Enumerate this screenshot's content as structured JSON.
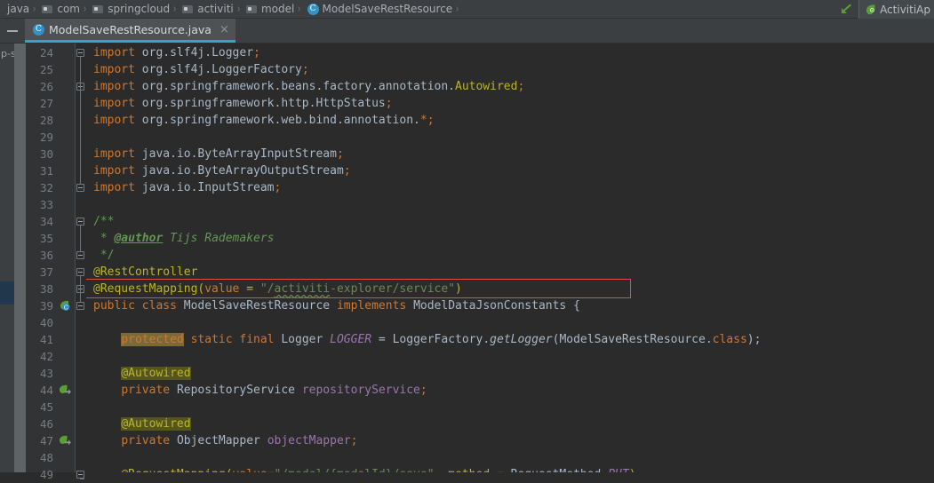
{
  "breadcrumb": {
    "items": [
      {
        "label": "java",
        "icon": "none"
      },
      {
        "label": "com",
        "icon": "folder-icon"
      },
      {
        "label": "springcloud",
        "icon": "folder-icon"
      },
      {
        "label": "activiti",
        "icon": "folder-icon"
      },
      {
        "label": "model",
        "icon": "folder-icon"
      },
      {
        "label": "ModelSaveRestResource",
        "icon": "class-icon"
      }
    ],
    "separator": "›"
  },
  "run_config": {
    "arrow_icon": "run-back-arrow-icon",
    "app_icon": "activiti-leaf-icon",
    "label": "ActivitiAp"
  },
  "tabs": {
    "collapse_label": "—",
    "items": [
      {
        "label": "ModelSaveRestResource.java",
        "icon": "class-icon",
        "close": "×",
        "active": true
      }
    ]
  },
  "tool_stripe": {
    "label": "p-sp"
  },
  "editor": {
    "first_line": 24,
    "line_height": 19,
    "gutter_icons": [
      {
        "line": 39,
        "name": "spring-bean-class-icon"
      },
      {
        "line": 44,
        "name": "spring-bean-autowired-icon"
      },
      {
        "line": 47,
        "name": "spring-bean-autowired-icon"
      }
    ],
    "highlight_box": {
      "line": 38,
      "label": "request-mapping-highlight"
    },
    "lines": [
      {
        "n": 24,
        "html": "<span class=\"kw\">import</span> <span class=\"id\">org.slf4j.Logger</span><span class=\"kw\">;</span>"
      },
      {
        "n": 25,
        "html": "<span class=\"kw\">import</span> <span class=\"id\">org.slf4j.LoggerFactory</span><span class=\"kw\">;</span>"
      },
      {
        "n": 26,
        "html": "<span class=\"kw\">import</span> <span class=\"id\">org.springframework.beans.factory.annotation.</span><span class=\"ann\">Autowired</span><span class=\"kw\">;</span>"
      },
      {
        "n": 27,
        "html": "<span class=\"kw\">import</span> <span class=\"id\">org.springframework.http.HttpStatus</span><span class=\"kw\">;</span>"
      },
      {
        "n": 28,
        "html": "<span class=\"kw\">import</span> <span class=\"id\">org.springframework.web.bind.annotation.</span><span class=\"kw\">*;</span>"
      },
      {
        "n": 29,
        "html": ""
      },
      {
        "n": 30,
        "html": "<span class=\"kw\">import</span> <span class=\"id\">java.io.ByteArrayInputStream</span><span class=\"kw\">;</span>"
      },
      {
        "n": 31,
        "html": "<span class=\"kw\">import</span> <span class=\"id\">java.io.ByteArrayOutputStream</span><span class=\"kw\">;</span>"
      },
      {
        "n": 32,
        "html": "<span class=\"kw\">import</span> <span class=\"id\">java.io.InputStream</span><span class=\"kw\">;</span>"
      },
      {
        "n": 33,
        "html": ""
      },
      {
        "n": 34,
        "html": "<span class=\"cmt\">/**</span>"
      },
      {
        "n": 35,
        "html": "<span class=\"cmt\"> * </span><span class=\"doctag\">@author</span><span class=\"docitl\"> Tijs Rademakers</span>"
      },
      {
        "n": 36,
        "html": "<span class=\"cmt\"> */</span>"
      },
      {
        "n": 37,
        "html": "<span class=\"ann\">@RestController</span>"
      },
      {
        "n": 38,
        "html": "<span class=\"ann\">@RequestMapping(</span><span class=\"kw\">value</span><span class=\"ann\"> = </span><span class=\"str\">\"/</span><span class=\"str wavy\">activiti</span><span class=\"str\">-explorer/service\"</span><span class=\"ann\">)</span>"
      },
      {
        "n": 39,
        "html": "<span class=\"kw\">public class</span> <span class=\"cls\">ModelSaveRestResource</span> <span class=\"kw\">implements</span> <span class=\"cls\">ModelDataJsonConstants</span> {"
      },
      {
        "n": 40,
        "html": ""
      },
      {
        "n": 41,
        "html": "    <span class=\"kw hl-kwbg\">protected</span> <span class=\"kw\">static final</span> <span class=\"cls\">Logger</span> <span class=\"stat\">LOGGER</span> = <span class=\"cls\">LoggerFactory</span>.<span class=\"mtd\">getLogger</span>(<span class=\"cls\">ModelSaveRestResource</span>.<span class=\"kw\">class</span>);"
      },
      {
        "n": 42,
        "html": ""
      },
      {
        "n": 43,
        "html": "    <span class=\"ann hl-srch\">@Autowired</span>"
      },
      {
        "n": 44,
        "html": "    <span class=\"kw\">private</span> <span class=\"cls\">RepositoryService</span> <span class=\"fld\">repositoryService</span><span class=\"kw\">;</span>"
      },
      {
        "n": 45,
        "html": ""
      },
      {
        "n": 46,
        "html": "    <span class=\"ann hl-srch\">@Autowired</span>"
      },
      {
        "n": 47,
        "html": "    <span class=\"kw\">private</span> <span class=\"cls\">ObjectMapper</span> <span class=\"fld\">objectMapper</span><span class=\"kw\">;</span>"
      },
      {
        "n": 48,
        "html": ""
      },
      {
        "n": 49,
        "html": "    <span class=\"ann\">@RequestMapping(</span><span class=\"kw\">value</span><span class=\"ann\">=</span><span class=\"str\">\"/model/{modelId}/save\"</span><span class=\"ann\">, method = </span><span class=\"cls\">RequestMethod</span><span class=\"ann\">.</span><span class=\"stat\">PUT</span><span class=\"ann\">)</span>"
      }
    ],
    "fold_markers": [
      24,
      26,
      32,
      34,
      36,
      37,
      38,
      39,
      49
    ],
    "source_text": [
      "import org.slf4j.Logger;",
      "import org.slf4j.LoggerFactory;",
      "import org.springframework.beans.factory.annotation.Autowired;",
      "import org.springframework.http.HttpStatus;",
      "import org.springframework.web.bind.annotation.*;",
      "",
      "import java.io.ByteArrayInputStream;",
      "import java.io.ByteArrayOutputStream;",
      "import java.io.InputStream;",
      "",
      "/**",
      " * @author Tijs Rademakers",
      " */",
      "@RestController",
      "@RequestMapping(value = \"/activiti-explorer/service\")",
      "public class ModelSaveRestResource implements ModelDataJsonConstants {",
      "",
      "    protected static final Logger LOGGER = LoggerFactory.getLogger(ModelSaveRestResource.class);",
      "",
      "    @Autowired",
      "    private RepositoryService repositoryService;",
      "",
      "    @Autowired",
      "    private ObjectMapper objectMapper;",
      "",
      "    @RequestMapping(value=\"/model/{modelId}/save\", method = RequestMethod.PUT)"
    ]
  },
  "colors": {
    "editor_bg": "#2b2b2b",
    "gutter_bg": "#313335",
    "chrome_bg": "#3c3f41",
    "tab_active_bg": "#4e5254",
    "tab_underline": "#2fa8c4",
    "keyword": "#cc7832",
    "string": "#6a8759",
    "comment": "#629755",
    "annotation": "#bbb529",
    "field": "#9876aa",
    "identifier": "#a9b7c6",
    "line_number": "#767c82",
    "highlight_box": "#e04a4a",
    "search_highlight": "#555520",
    "keyword_highlight": "#7a6a37"
  }
}
